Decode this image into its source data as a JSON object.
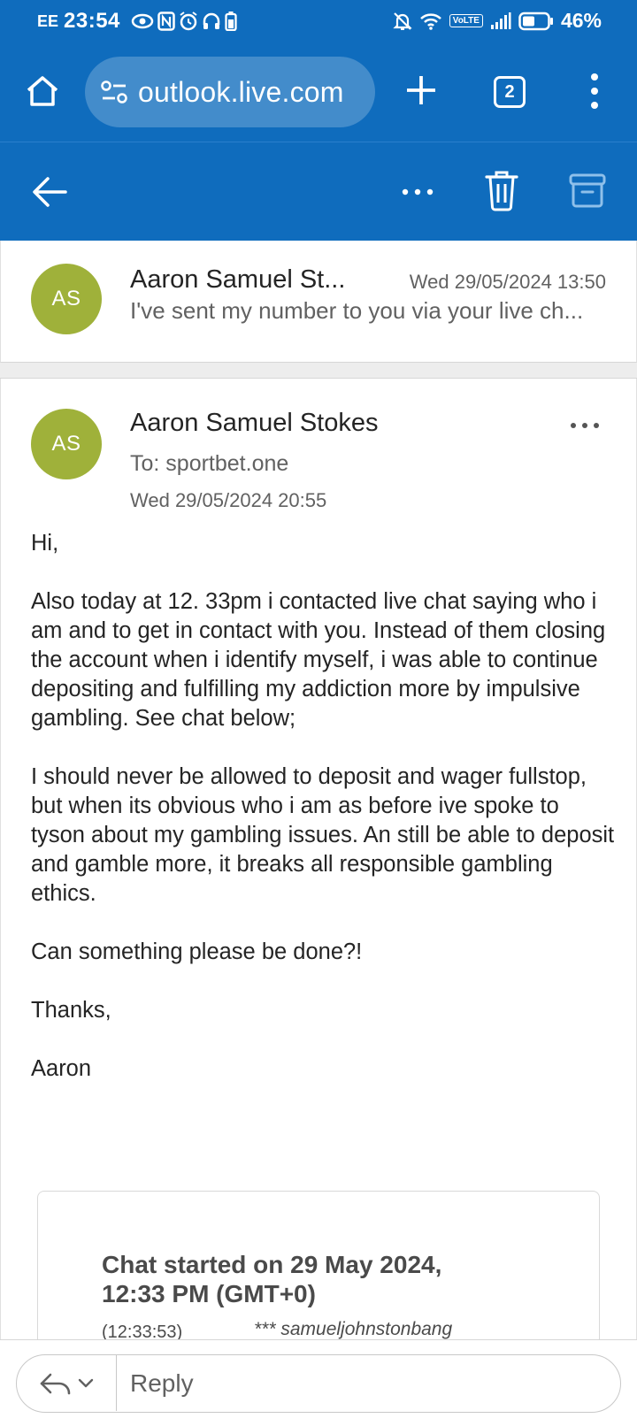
{
  "status_bar": {
    "carrier": "EE",
    "time": "23:54",
    "network": "VoLTE",
    "battery_pct": "46%"
  },
  "browser": {
    "url": "outlook.live.com",
    "tab_count": "2"
  },
  "thread": {
    "previous": {
      "avatar_initials": "AS",
      "sender": "Aaron Samuel St...",
      "date": "Wed 29/05/2024 13:50",
      "preview": "I've sent my number to you via your live ch..."
    },
    "current": {
      "avatar_initials": "AS",
      "sender": "Aaron Samuel Stokes",
      "to": "To: sportbet.one",
      "date": "Wed 29/05/2024 20:55",
      "body": [
        "Hi,",
        "Also today at 12. 33pm i contacted live chat saying who i am and to get in contact with you. Instead of them closing the account when i identify myself, i was able to continue depositing and fulfilling my addiction more by impulsive gambling. See chat below;",
        "I should never be allowed to deposit and wager fullstop, but when its obvious who i am as before ive spoke to tyson about my gambling issues. An still be able to deposit and gamble more, it breaks all responsible gambling ethics.",
        "Can something please be done?!",
        "Thanks,",
        "Aaron"
      ],
      "chat_transcript": {
        "title": "Chat started on 29 May 2024, 12:33 PM (GMT+0)",
        "first_time": "(12:33:53)",
        "first_user": "*** samueljohnstonbang"
      }
    }
  },
  "reply_bar": {
    "placeholder": "Reply"
  },
  "colors": {
    "brand_blue": "#0f6cbd",
    "avatar_green": "#9fb13a"
  }
}
